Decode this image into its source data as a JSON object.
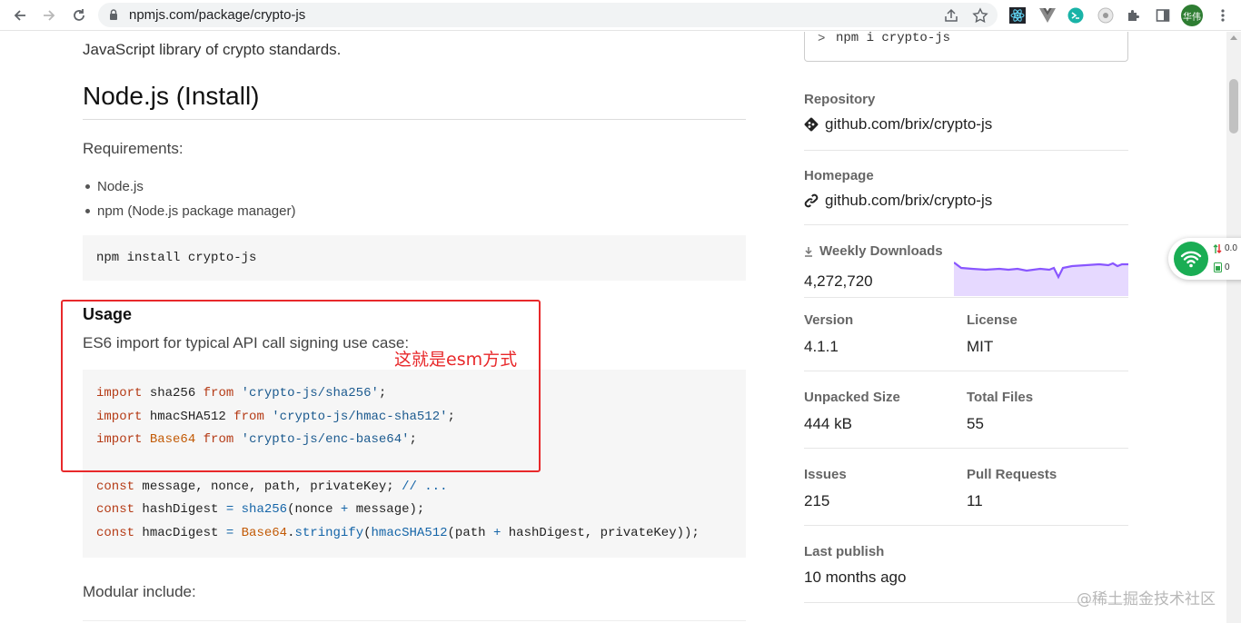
{
  "browser": {
    "url": "npmjs.com/package/crypto-js",
    "profile_label": "华伟"
  },
  "readme": {
    "description": "JavaScript library of crypto standards.",
    "install_heading": "Node.js (Install)",
    "requirements_label": "Requirements:",
    "requirements": [
      "Node.js",
      "npm (Node.js package manager)"
    ],
    "install_code": "npm install crypto-js",
    "usage_heading": "Usage",
    "usage_desc": "ES6 import for typical API call signing use case:",
    "modular_include": "Modular include:"
  },
  "annotation": {
    "text": "这就是esm方式",
    "color": "#e8292b"
  },
  "sidebar": {
    "install_prompt": ">",
    "install_cmd": "npm i crypto-js",
    "repository_label": "Repository",
    "repository_link": "github.com/brix/crypto-js",
    "homepage_label": "Homepage",
    "homepage_link": "github.com/brix/crypto-js",
    "weekly_downloads_label": "Weekly Downloads",
    "weekly_downloads": "4,272,720",
    "version_label": "Version",
    "version": "4.1.1",
    "license_label": "License",
    "license": "MIT",
    "unpacked_size_label": "Unpacked Size",
    "unpacked_size": "444 kB",
    "total_files_label": "Total Files",
    "total_files": "55",
    "issues_label": "Issues",
    "issues": "215",
    "pull_requests_label": "Pull Requests",
    "pull_requests": "11",
    "last_publish_label": "Last publish",
    "last_publish": "10 months ago",
    "graph_color": "#8956ff"
  },
  "widget": {
    "speed_up": "0.0",
    "speed_down": "0"
  },
  "watermark": "@稀土掘金技术社区"
}
